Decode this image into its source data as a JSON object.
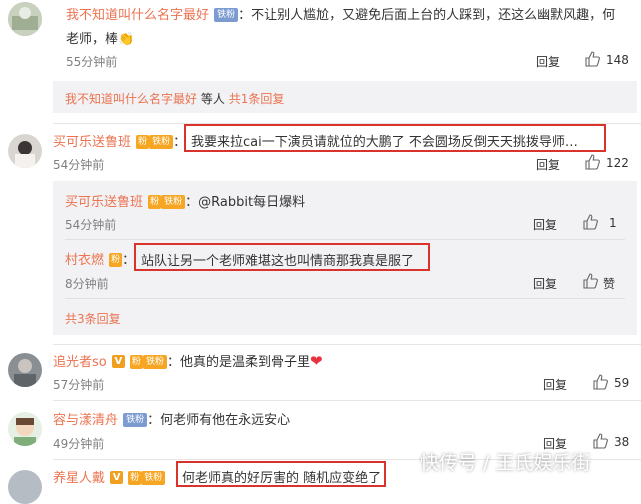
{
  "c1": {
    "name": "我不知道叫什么名字最好",
    "badge": "铁粉",
    "text_line1": "：不让别人尴尬，又避免后面上台的人踩到，还这么幽默风趣，何",
    "text_line2": "老师，棒",
    "emoji": "👏",
    "time": "55分钟前",
    "reply": "回复",
    "likes": "148",
    "sub_name": "我不知道叫什么名字最好",
    "sub_text": "等人",
    "sub_more": "共1条回复"
  },
  "c2": {
    "name": "买可乐送鲁班",
    "badge_fans": "粉",
    "badge_iron": "铁粉",
    "colon": "：",
    "text": "我要来拉cai一下演员请就位的大鹏了 不会圆场反倒天天挑拨导师…",
    "time": "54分钟前",
    "reply": "回复",
    "likes": "122",
    "r1_name": "买可乐送鲁班",
    "r1_text": "：@Rabbit每日爆料",
    "r1_time": "54分钟前",
    "r1_reply": "回复",
    "r1_likes": "1",
    "r2_name": "村衣燃",
    "r2_colon": "：",
    "r2_text": "站队让另一个老师难堪这也叫情商那我真是服了",
    "r2_time": "8分钟前",
    "r2_reply": "回复",
    "r2_likes": "赞",
    "more": "共3条回复"
  },
  "c3": {
    "name": "追光者so",
    "vip": "V",
    "badge_iron": "铁粉",
    "text": "：他真的是温柔到骨子里",
    "heart": "❤",
    "time": "57分钟前",
    "reply": "回复",
    "likes": "59"
  },
  "c4": {
    "name": "容与漾清舟",
    "badge": "铁粉",
    "text": "：何老师有他在永远安心",
    "time": "49分钟前",
    "reply": "回复",
    "likes": "38"
  },
  "c5": {
    "name": "养星人戴",
    "vip": "V",
    "text": "何老师真的好厉害的 随机应变绝了"
  },
  "watermark": "快传号 / 王氏娱乐街",
  "colors": {
    "name": "#eb7350",
    "highlight": "#d8342c",
    "panel": "#f2f2f5"
  }
}
